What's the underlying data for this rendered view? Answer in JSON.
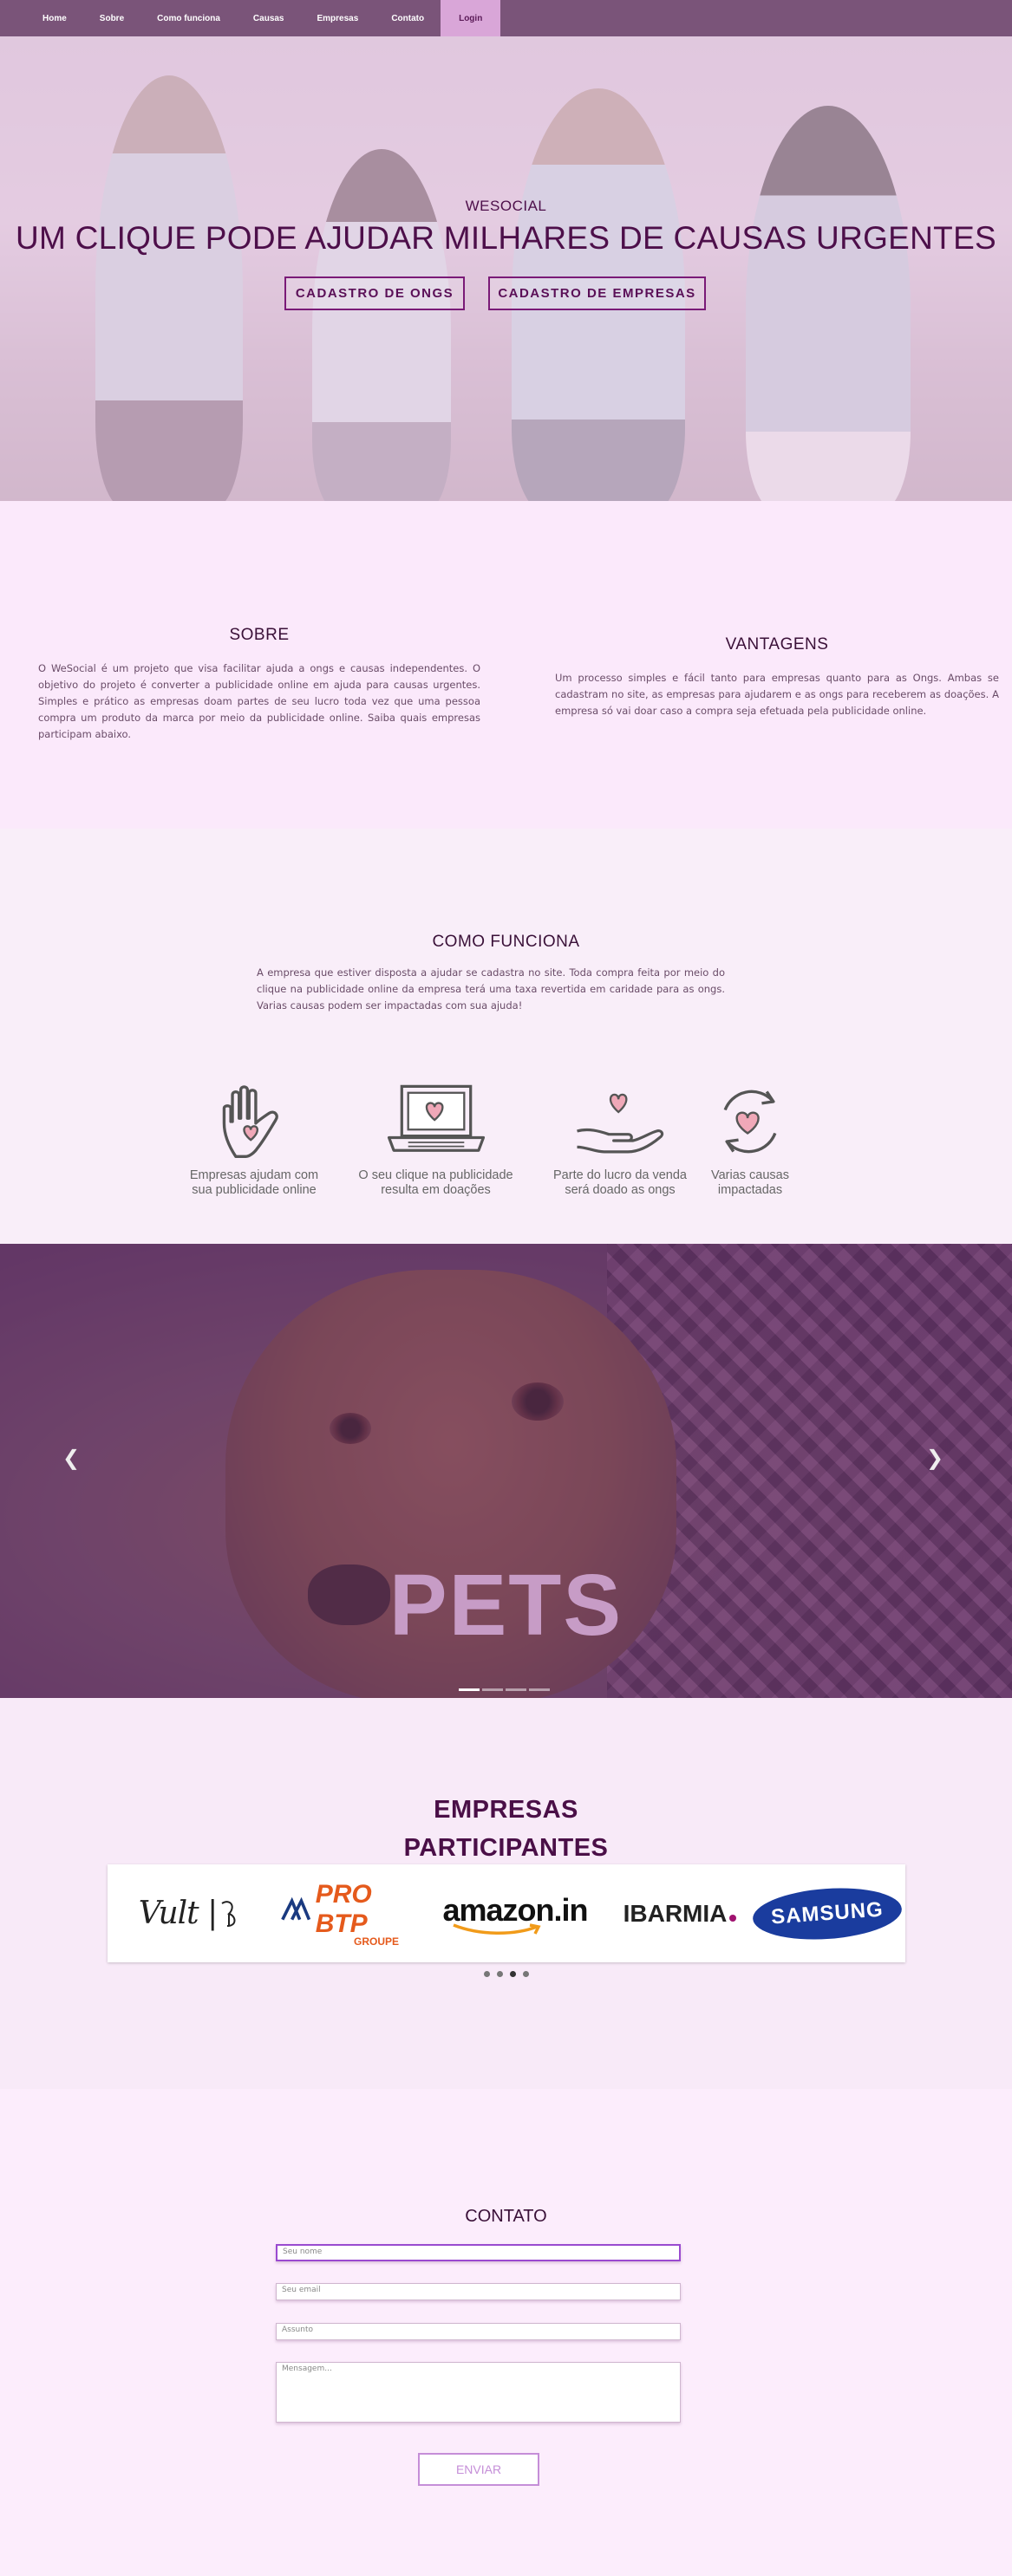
{
  "nav": {
    "items": [
      {
        "label": "Home"
      },
      {
        "label": "Sobre"
      },
      {
        "label": "Como funciona"
      },
      {
        "label": "Causas"
      },
      {
        "label": "Empresas"
      },
      {
        "label": "Contato"
      }
    ],
    "login_label": "Login",
    "colors": {
      "bar": "#7a5479",
      "login_bg": "#d9a6d8"
    }
  },
  "hero": {
    "subtitle": "WESOCIAL",
    "title": "UM CLIQUE PODE AJUDAR MILHARES DE CAUSAS URGENTES",
    "btn_ongs": "CADASTRO DE ONGS",
    "btn_empresas": "CADASTRO DE EMPRESAS",
    "accent": "#4d0f4a"
  },
  "sobre": {
    "title": "SOBRE",
    "text": "O WeSocial é um projeto que visa facilitar ajuda a ongs e causas independentes. O objetivo do projeto é converter a publicidade online em ajuda para causas urgentes. Simples e prático as empresas doam partes de seu lucro toda vez que uma pessoa compra um produto da marca por meio da publicidade online. Saiba quais empresas participam abaixo."
  },
  "vantagens": {
    "title": "VANTAGENS",
    "text": "Um processo simples e fácil tanto para empresas quanto para as Ongs. Ambas se cadastram no site, as empresas para ajudarem e as ongs para receberem as doações. A empresa só vai doar caso a compra seja efetuada pela publicidade online."
  },
  "como_funciona": {
    "title": "COMO FUNCIONA",
    "text": "A empresa que estiver disposta a ajudar se cadastra no site. Toda compra feita por meio do clique na publicidade online da empresa terá uma taxa revertida em caridade para as ongs. Varias causas podem ser impactadas com sua ajuda!",
    "steps": [
      {
        "icon": "hand-heart-icon",
        "line1": "Empresas ajudam com",
        "line2": "sua publicidade online"
      },
      {
        "icon": "laptop-heart-icon",
        "line1": "O seu clique na publicidade",
        "line2": "resulta em doações"
      },
      {
        "icon": "palm-heart-icon",
        "line1": "Parte do lucro da venda",
        "line2": "será doado as ongs"
      },
      {
        "icon": "cycle-heart-icon",
        "line1": "Varias causas",
        "line2": "impactadas"
      }
    ]
  },
  "carousel": {
    "caption": "PETS",
    "prev_icon": "chevron-left-icon",
    "next_icon": "chevron-right-icon",
    "slide_count": 4,
    "active_index": 0
  },
  "empresas": {
    "title_line1": "EMPRESAS",
    "title_line2": "PARTICIPANTES",
    "logos": [
      {
        "name": "Vult",
        "text": "Vult |"
      },
      {
        "name": "PRO BTP GROUPE",
        "text": "PRO BTP",
        "sub": "GROUPE"
      },
      {
        "name": "amazon.in",
        "text": "amazon.in"
      },
      {
        "name": "IBARMIA",
        "text": "IBARMIA"
      },
      {
        "name": "SAMSUNG",
        "text": "SAMSUNG"
      }
    ],
    "dot_count": 4,
    "active_dot": 2
  },
  "contato": {
    "title": "CONTATO",
    "name_placeholder": "Seu nome",
    "email_placeholder": "Seu email",
    "subject_placeholder": "Assunto",
    "message_placeholder": "Mensagem...",
    "send_label": "ENVIAR"
  }
}
